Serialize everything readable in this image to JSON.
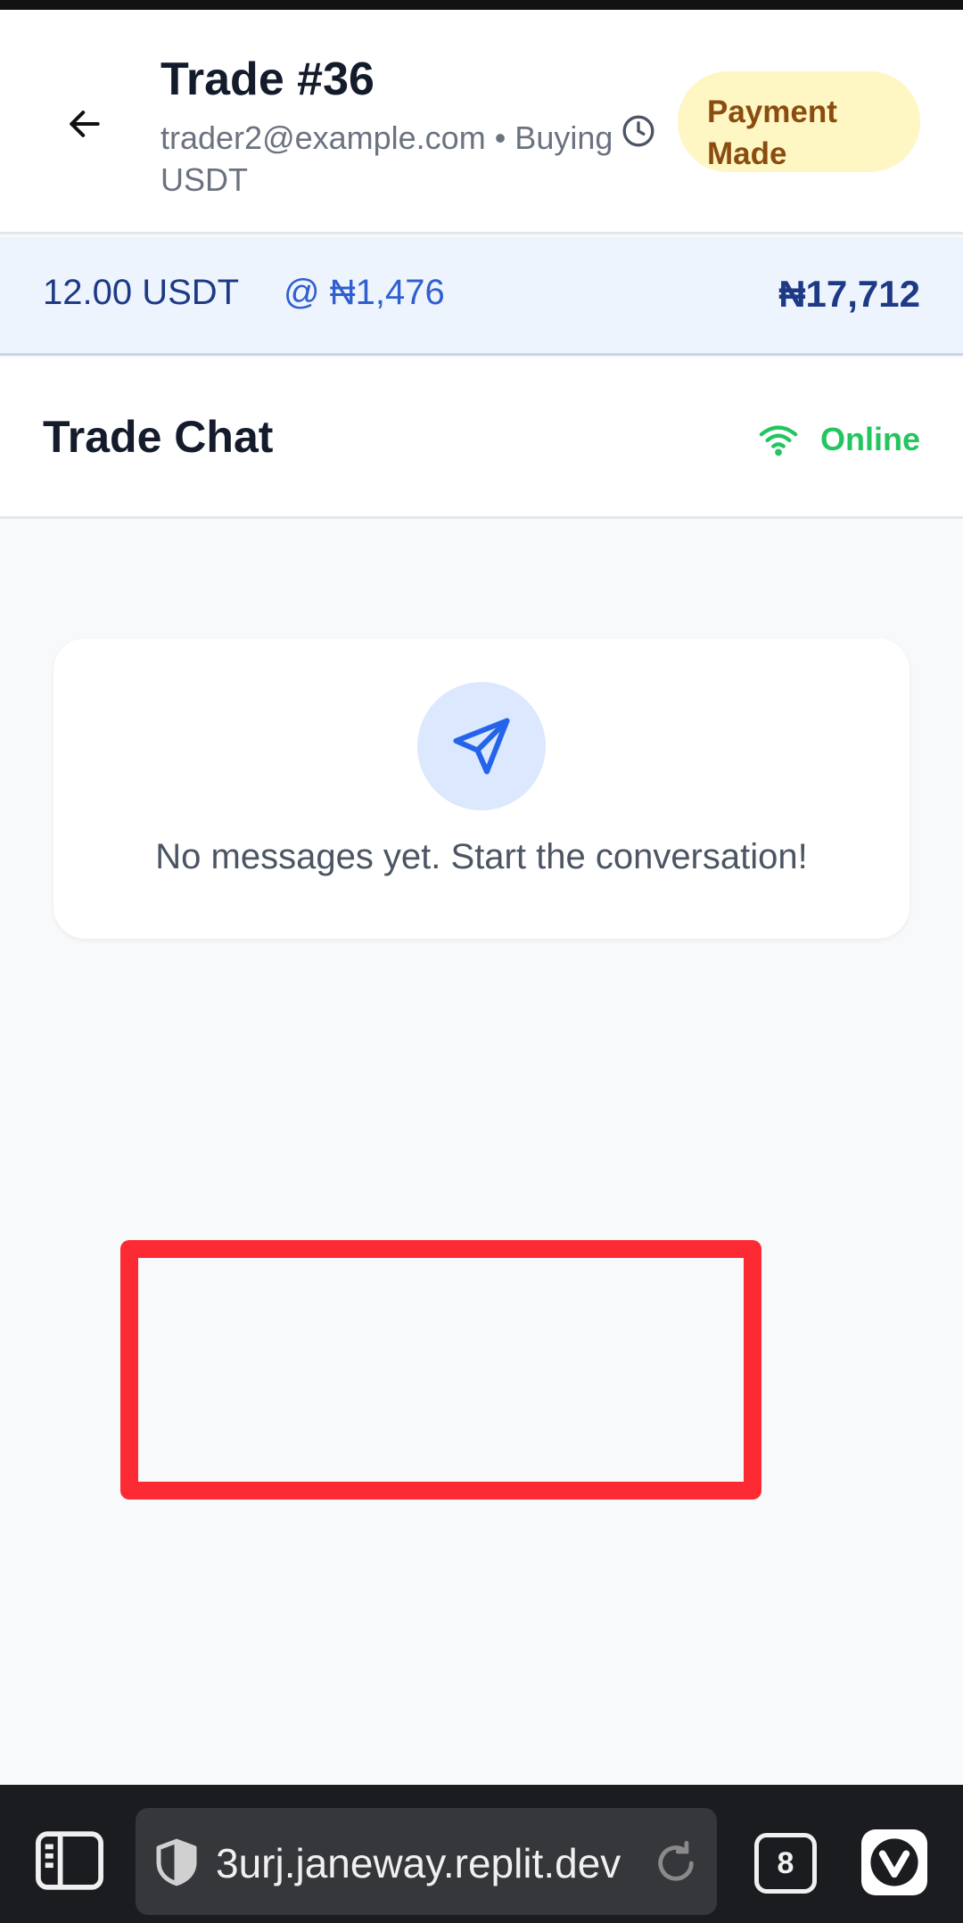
{
  "header": {
    "title": "Trade #36",
    "subtitle": "trader2@example.com • Buying USDT",
    "status": "Payment Made"
  },
  "summary": {
    "quantity": "12.00 USDT",
    "rate": "@ ₦1,476",
    "total": "₦17,712"
  },
  "chat": {
    "title": "Trade Chat",
    "connection": "Online",
    "empty_message": "No messages yet. Start the conversation!"
  },
  "browser": {
    "url": "3urj.janeway.replit.dev",
    "tab_count": "8"
  },
  "colors": {
    "accent": "#2563eb",
    "online": "#22c55e",
    "status_badge_bg": "#fef6c3",
    "status_badge_text": "#8a4d0f",
    "annotation_red": "#fc2b33"
  },
  "icons": [
    "back-arrow-icon",
    "clock-icon",
    "wifi-icon",
    "send-icon",
    "sidebar-icon",
    "shield-icon",
    "reload-icon",
    "vivaldi-icon"
  ]
}
